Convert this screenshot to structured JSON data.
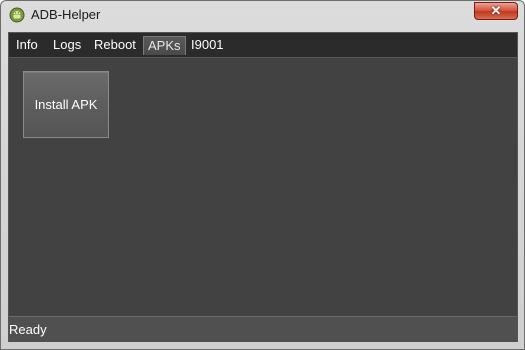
{
  "window": {
    "title": "ADB-Helper",
    "close_glyph": "✕",
    "icon": "android-icon"
  },
  "tabs": [
    {
      "label": "Info",
      "active": false
    },
    {
      "label": "Logs",
      "active": false
    },
    {
      "label": "Reboot",
      "active": false
    },
    {
      "label": "APKs",
      "active": true
    },
    {
      "label": "I9001",
      "active": false
    }
  ],
  "main": {
    "install_button_label": "Install APK"
  },
  "status": {
    "text": "Ready"
  },
  "colors": {
    "client_bg": "#424242",
    "tabbar_bg": "#2b2b2b",
    "close_red": "#c13a22"
  }
}
